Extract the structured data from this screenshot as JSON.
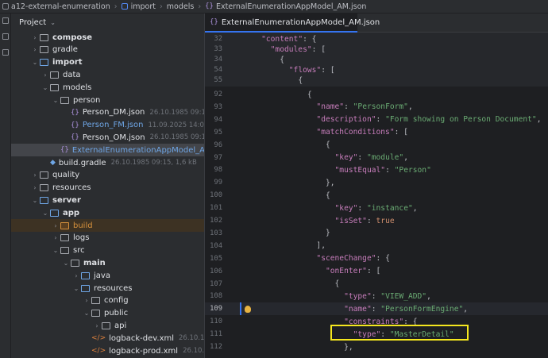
{
  "breadcrumb": [
    "a12-external-enumeration",
    "import",
    "models",
    "ExternalEnumerationAppModel_AM.json"
  ],
  "project": {
    "title": "Project",
    "tree": [
      {
        "indent": 2,
        "arrow": "›",
        "icon": "folder-icon",
        "name": "compose",
        "style": "bold",
        "meta": ""
      },
      {
        "indent": 2,
        "arrow": "›",
        "icon": "folder-icon",
        "name": "gradle",
        "style": "",
        "meta": ""
      },
      {
        "indent": 2,
        "arrow": "⌄",
        "icon": "module-folder-icon",
        "name": "import",
        "style": "bold",
        "meta": ""
      },
      {
        "indent": 3,
        "arrow": "›",
        "icon": "folder-icon",
        "name": "data",
        "style": "",
        "meta": ""
      },
      {
        "indent": 3,
        "arrow": "⌄",
        "icon": "folder-icon",
        "name": "models",
        "style": "",
        "meta": ""
      },
      {
        "indent": 4,
        "arrow": "⌄",
        "icon": "folder-icon",
        "name": "person",
        "style": "",
        "meta": ""
      },
      {
        "indent": 5,
        "arrow": "",
        "icon": "json-file-icon",
        "name": "Person_DM.json",
        "style": "",
        "meta": "26.10.1985 09:15, 2"
      },
      {
        "indent": 5,
        "arrow": "",
        "icon": "json-file-icon",
        "name": "Person_FM.json",
        "style": "blue",
        "meta": "11.09.2025 14:06, 12"
      },
      {
        "indent": 5,
        "arrow": "",
        "icon": "json-file-icon",
        "name": "Person_OM.json",
        "style": "",
        "meta": "26.10.1985 09:15, 3"
      },
      {
        "indent": 4,
        "arrow": "",
        "icon": "json-file-icon",
        "name": "ExternalEnumerationAppModel_AM.json",
        "style": "blue",
        "meta": "",
        "selected": true
      },
      {
        "indent": 3,
        "arrow": "",
        "icon": "gradle-file-icon",
        "name": "build.gradle",
        "style": "",
        "meta": "26.10.1985 09:15, 1,6 kB"
      },
      {
        "indent": 2,
        "arrow": "›",
        "icon": "folder-icon",
        "name": "quality",
        "style": "",
        "meta": ""
      },
      {
        "indent": 2,
        "arrow": "›",
        "icon": "folder-icon",
        "name": "resources",
        "style": "",
        "meta": ""
      },
      {
        "indent": 2,
        "arrow": "⌄",
        "icon": "module-folder-icon",
        "name": "server",
        "style": "bold",
        "meta": ""
      },
      {
        "indent": 3,
        "arrow": "⌄",
        "icon": "module-folder-icon",
        "name": "app",
        "style": "bold",
        "meta": ""
      },
      {
        "indent": 4,
        "arrow": "›",
        "icon": "build-folder-icon",
        "name": "build",
        "style": "orange",
        "meta": "",
        "buildhl": true
      },
      {
        "indent": 4,
        "arrow": "›",
        "icon": "folder-icon",
        "name": "logs",
        "style": "",
        "meta": ""
      },
      {
        "indent": 4,
        "arrow": "⌄",
        "icon": "folder-icon",
        "name": "src",
        "style": "",
        "meta": ""
      },
      {
        "indent": 5,
        "arrow": "⌄",
        "icon": "folder-icon",
        "name": "main",
        "style": "bold",
        "meta": ""
      },
      {
        "indent": 6,
        "arrow": "›",
        "icon": "source-folder-icon",
        "name": "java",
        "style": "",
        "meta": ""
      },
      {
        "indent": 6,
        "arrow": "⌄",
        "icon": "resources-folder-icon",
        "name": "resources",
        "style": "",
        "meta": ""
      },
      {
        "indent": 7,
        "arrow": "›",
        "icon": "folder-icon",
        "name": "config",
        "style": "",
        "meta": ""
      },
      {
        "indent": 7,
        "arrow": "⌄",
        "icon": "folder-icon",
        "name": "public",
        "style": "",
        "meta": ""
      },
      {
        "indent": 8,
        "arrow": "›",
        "icon": "folder-icon",
        "name": "api",
        "style": "",
        "meta": ""
      },
      {
        "indent": 7,
        "arrow": "",
        "icon": "xml-file-icon",
        "name": "logback-dev.xml",
        "style": "",
        "meta": "26.10.1985"
      },
      {
        "indent": 7,
        "arrow": "",
        "icon": "xml-file-icon",
        "name": "logback-prod.xml",
        "style": "",
        "meta": "26.10.1985"
      }
    ]
  },
  "editor": {
    "tab_label": "ExternalEnumerationAppModel_AM.json",
    "sticky": [
      {
        "num": "32",
        "depth": 2,
        "tokens": [
          [
            "k",
            "\"content\""
          ],
          [
            "p",
            ": {"
          ]
        ]
      },
      {
        "num": "33",
        "depth": 3,
        "tokens": [
          [
            "k",
            "\"modules\""
          ],
          [
            "p",
            ": ["
          ]
        ]
      },
      {
        "num": "34",
        "depth": 4,
        "tokens": [
          [
            "p",
            "{"
          ]
        ]
      },
      {
        "num": "54",
        "depth": 5,
        "tokens": [
          [
            "k",
            "\"flows\""
          ],
          [
            "p",
            ": ["
          ]
        ]
      },
      {
        "num": "55",
        "depth": 6,
        "tokens": [
          [
            "p",
            "{"
          ]
        ]
      }
    ],
    "lines": [
      {
        "num": "92",
        "depth": 7,
        "tokens": [
          [
            "p",
            "{"
          ]
        ]
      },
      {
        "num": "93",
        "depth": 8,
        "tokens": [
          [
            "k",
            "\"name\""
          ],
          [
            "p",
            ": "
          ],
          [
            "s",
            "\"PersonForm\""
          ],
          [
            "p",
            ","
          ]
        ]
      },
      {
        "num": "94",
        "depth": 8,
        "tokens": [
          [
            "k",
            "\"description\""
          ],
          [
            "p",
            ": "
          ],
          [
            "s",
            "\"Form showing on Person Document\""
          ],
          [
            "p",
            ","
          ]
        ]
      },
      {
        "num": "95",
        "depth": 8,
        "tokens": [
          [
            "k",
            "\"matchConditions\""
          ],
          [
            "p",
            ": ["
          ]
        ]
      },
      {
        "num": "96",
        "depth": 9,
        "tokens": [
          [
            "p",
            "{"
          ]
        ]
      },
      {
        "num": "97",
        "depth": 10,
        "tokens": [
          [
            "k",
            "\"key\""
          ],
          [
            "p",
            ": "
          ],
          [
            "s",
            "\"module\""
          ],
          [
            "p",
            ","
          ]
        ]
      },
      {
        "num": "98",
        "depth": 10,
        "tokens": [
          [
            "k",
            "\"mustEqual\""
          ],
          [
            "p",
            ": "
          ],
          [
            "s",
            "\"Person\""
          ]
        ]
      },
      {
        "num": "99",
        "depth": 9,
        "tokens": [
          [
            "p",
            "},"
          ]
        ]
      },
      {
        "num": "100",
        "depth": 9,
        "tokens": [
          [
            "p",
            "{"
          ]
        ]
      },
      {
        "num": "101",
        "depth": 10,
        "tokens": [
          [
            "k",
            "\"key\""
          ],
          [
            "p",
            ": "
          ],
          [
            "s",
            "\"instance\""
          ],
          [
            "p",
            ","
          ]
        ]
      },
      {
        "num": "102",
        "depth": 10,
        "tokens": [
          [
            "k",
            "\"isSet\""
          ],
          [
            "p",
            ": "
          ],
          [
            "kw",
            "true"
          ]
        ]
      },
      {
        "num": "103",
        "depth": 9,
        "tokens": [
          [
            "p",
            "}"
          ]
        ]
      },
      {
        "num": "104",
        "depth": 8,
        "tokens": [
          [
            "p",
            "],"
          ]
        ]
      },
      {
        "num": "105",
        "depth": 8,
        "tokens": [
          [
            "k",
            "\"sceneChange\""
          ],
          [
            "p",
            ": {"
          ]
        ]
      },
      {
        "num": "106",
        "depth": 9,
        "tokens": [
          [
            "k",
            "\"onEnter\""
          ],
          [
            "p",
            ": ["
          ]
        ]
      },
      {
        "num": "107",
        "depth": 10,
        "tokens": [
          [
            "p",
            "{"
          ]
        ]
      },
      {
        "num": "108",
        "depth": 11,
        "tokens": [
          [
            "k",
            "\"type\""
          ],
          [
            "p",
            ": "
          ],
          [
            "s",
            "\"VIEW_ADD\""
          ],
          [
            "p",
            ","
          ]
        ]
      },
      {
        "num": "109",
        "depth": 11,
        "tokens": [
          [
            "k",
            "\"name\""
          ],
          [
            "p",
            ": "
          ],
          [
            "s",
            "\"PersonFormEngine\""
          ],
          [
            "p",
            ","
          ]
        ],
        "current": true
      },
      {
        "num": "110",
        "depth": 11,
        "tokens": [
          [
            "k",
            "\"constraints\""
          ],
          [
            "p",
            ": {"
          ]
        ]
      },
      {
        "num": "111",
        "depth": 12,
        "tokens": [
          [
            "k",
            "\"type\""
          ],
          [
            "p",
            ": "
          ],
          [
            "s",
            "\"MasterDetail\""
          ]
        ]
      },
      {
        "num": "112",
        "depth": 11,
        "tokens": [
          [
            "p",
            "},"
          ]
        ]
      }
    ]
  }
}
